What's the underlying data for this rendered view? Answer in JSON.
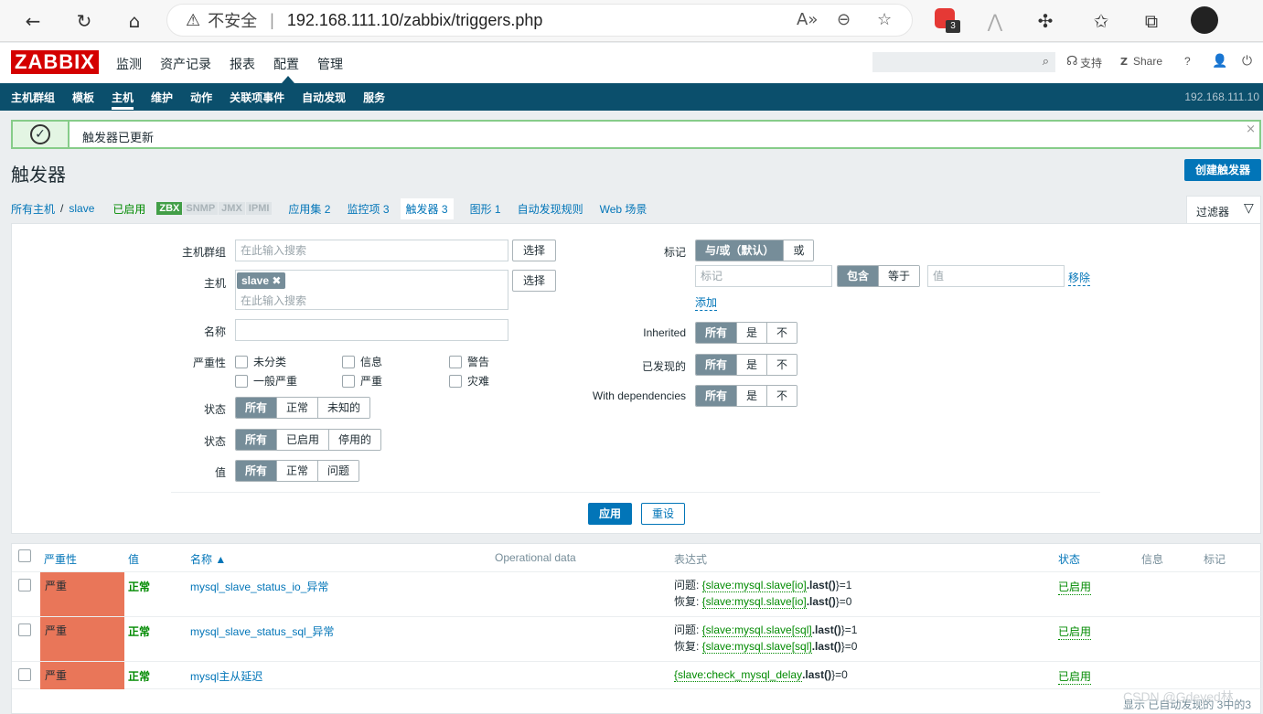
{
  "browser": {
    "insecure_label": "不安全",
    "url": "192.168.111.10/zabbix/triggers.php",
    "extension_badge": "3"
  },
  "header": {
    "logo": "ZABBIX",
    "menu": [
      "监测",
      "资产记录",
      "报表",
      "配置",
      "管理"
    ],
    "active_menu": "配置",
    "support": "支持",
    "share": "Share",
    "help": "?"
  },
  "submenu": {
    "items": [
      "主机群组",
      "模板",
      "主机",
      "维护",
      "动作",
      "关联项事件",
      "自动发现",
      "服务"
    ],
    "active": "主机",
    "server": "192.168.111.10"
  },
  "message": {
    "text": "触发器已更新",
    "close": "×"
  },
  "page": {
    "title": "触发器",
    "create_button": "创建触发器"
  },
  "hostnav": {
    "all_hosts": "所有主机",
    "sep": "/",
    "host": "slave",
    "status": "已启用",
    "tags": [
      "ZBX",
      "SNMP",
      "JMX",
      "IPMI"
    ],
    "tabs": [
      {
        "label": "应用集",
        "count": "2"
      },
      {
        "label": "监控项",
        "count": "3"
      },
      {
        "label": "触发器",
        "count": "3"
      },
      {
        "label": "图形",
        "count": "1"
      },
      {
        "label": "自动发现规则",
        "count": ""
      },
      {
        "label": "Web 场景",
        "count": ""
      }
    ]
  },
  "filter": {
    "tab_label": "过滤器",
    "host_group_label": "主机群组",
    "host_group_placeholder": "在此输入搜索",
    "select": "选择",
    "host_label": "主机",
    "host_tag": "slave",
    "host_placeholder": "在此输入搜索",
    "name_label": "名称",
    "severity_label": "严重性",
    "severities": [
      "未分类",
      "信息",
      "警告",
      "一般严重",
      "严重",
      "灾难"
    ],
    "state_label": "状态",
    "state_options": [
      "所有",
      "正常",
      "未知的"
    ],
    "status_label": "状态",
    "status_options": [
      "所有",
      "已启用",
      "停用的"
    ],
    "value_label": "值",
    "value_options": [
      "所有",
      "正常",
      "问题"
    ],
    "tags_label": "标记",
    "tags_eval": [
      "与/或（默认）",
      "或"
    ],
    "tag_placeholder": "标记",
    "tag_operator": [
      "包含",
      "等于"
    ],
    "tag_value_placeholder": "值",
    "remove": "移除",
    "add": "添加",
    "inherited_label": "Inherited",
    "discovered_label": "已发现的",
    "deps_label": "With dependencies",
    "tri_options": [
      "所有",
      "是",
      "不"
    ],
    "apply": "应用",
    "reset": "重设"
  },
  "table": {
    "headers": {
      "severity": "严重性",
      "value": "值",
      "name": "名称 ▲",
      "opdata": "Operational data",
      "expression": "表达式",
      "status": "状态",
      "info": "信息",
      "tags": "标记"
    },
    "rows": [
      {
        "severity": "严重",
        "value": "正常",
        "name": "mysql_slave_status_io_异常",
        "problem_prefix": "问题: ",
        "problem_item": "{slave:mysql.slave[io]",
        "problem_func": ".last()",
        "problem_suffix": "}=1",
        "recovery_prefix": "恢复: ",
        "recovery_item": "{slave:mysql.slave[io]",
        "recovery_func": ".last()",
        "recovery_suffix": "}=0",
        "status": "已启用"
      },
      {
        "severity": "严重",
        "value": "正常",
        "name": "mysql_slave_status_sql_异常",
        "problem_prefix": "问题: ",
        "problem_item": "{slave:mysql.slave[sql]",
        "problem_func": ".last()",
        "problem_suffix": "}=1",
        "recovery_prefix": "恢复: ",
        "recovery_item": "{slave:mysql.slave[sql]",
        "recovery_func": ".last()",
        "recovery_suffix": "}=0",
        "status": "已启用"
      },
      {
        "severity": "严重",
        "value": "正常",
        "name": "mysql主从延迟",
        "problem_item": "{slave:check_mysql_delay",
        "problem_func": ".last()",
        "problem_suffix": "}=0",
        "status": "已启用"
      }
    ],
    "footer": "显示 已自动发现的 3中的3"
  },
  "watermark": "CSDN @Gdeyed林",
  "colors": {
    "brand": "#d40000",
    "nav": "#0b4f6c",
    "severity_high": "#e97659",
    "ok_green": "#008a00",
    "link": "#0275b8"
  }
}
